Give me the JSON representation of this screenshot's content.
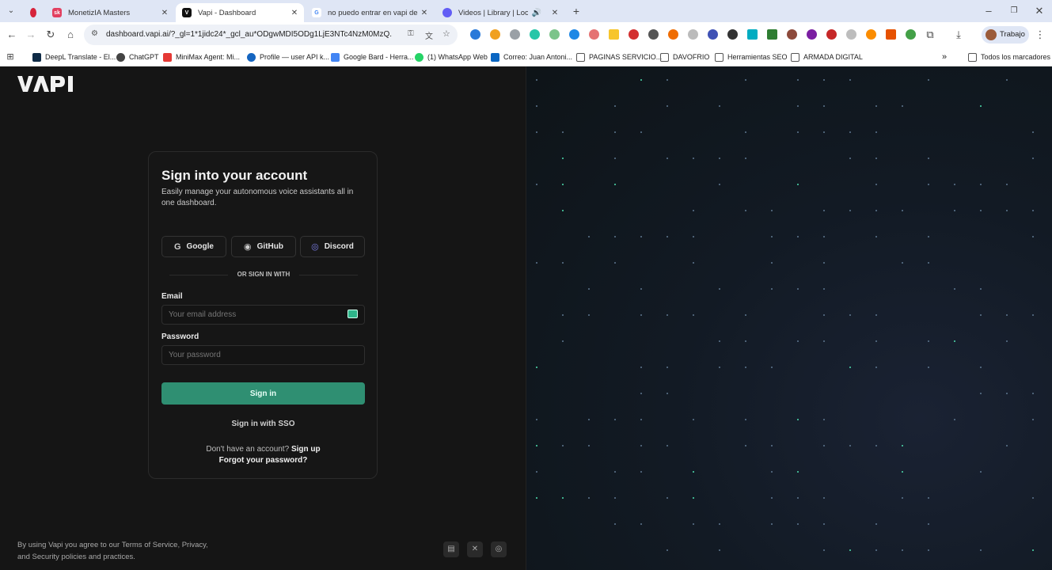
{
  "browser": {
    "tabs": [
      {
        "title": "MonetizIA Masters",
        "favicon": "sk",
        "active": false
      },
      {
        "title": "Vapi - Dashboard",
        "favicon": "vapi-logo",
        "active": true
      },
      {
        "title": "no puedo entrar en vapi desde",
        "favicon": "google-icon",
        "active": false
      },
      {
        "title": "Videos | Library | Loom",
        "favicon": "loom-icon",
        "active": false
      }
    ],
    "new_tab_label": "+",
    "url": "dashboard.vapi.ai/?_gl=1*1jidc24*_gcl_au*ODgwMDI5ODg1LjE3NTc4NzM0MzQ.",
    "profile_name": "Trabajo",
    "bookmarks": [
      "DeepL Translate - El...",
      "ChatGPT",
      "MiniMax Agent: Mi...",
      "Profile — user API k...",
      "Google Bard - Herra...",
      "(1) WhatsApp Web",
      "Correo: Juan Antoni...",
      "PAGINAS SERVICIO...",
      "DAVOFRIO",
      "Herramientas SEO",
      "ARMADA DIGITAL"
    ],
    "all_bookmarks_label": "Todos los marcadores"
  },
  "auth": {
    "title": "Sign into your account",
    "subtitle": "Easily manage your autonomous voice assistants all in one dashboard.",
    "google_label": "Google",
    "github_label": "GitHub",
    "discord_label": "Discord",
    "divider": "OR SIGN IN WITH",
    "email_label": "Email",
    "email_placeholder": "Your email address",
    "password_label": "Password",
    "password_placeholder": "Your password",
    "signin_label": "Sign in",
    "sso_label": "Sign in with SSO",
    "no_account_text": "Don't have an account?",
    "signup_label": "Sign up",
    "forgot_label": "Forgot your password?"
  },
  "footer": {
    "legal_line1_prefix": "By using Vapi you agree to our",
    "terms": "Terms of Service",
    "privacy": "Privacy",
    "legal_line2_prefix": "and",
    "security": "Security policies and practices",
    "legal_end": "."
  },
  "colors": {
    "accent": "#2f8f72",
    "background": "#151515",
    "tabstrip": "#dfe6f5"
  }
}
